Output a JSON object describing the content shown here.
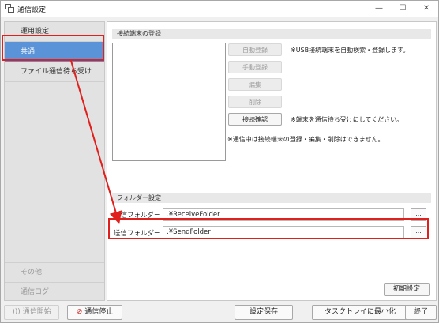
{
  "window": {
    "title": "通信設定",
    "minimize_glyph": "—",
    "maximize_glyph": "☐",
    "close_glyph": "✕"
  },
  "sidebar": {
    "items": [
      {
        "label": "運用設定"
      },
      {
        "label": "共通"
      },
      {
        "label": "ファイル通信待ち受け"
      },
      {
        "label": "その他"
      },
      {
        "label": "通信ログ"
      }
    ],
    "selected_index": 1
  },
  "device_group": {
    "header": "接続端末の登録",
    "buttons": {
      "auto_register": "自動登録",
      "manual_register": "手動登録",
      "edit": "編集",
      "delete": "削除",
      "confirm_connection": "接続確認"
    },
    "note_usb": "※USB接続端末を自動検索・登録します。",
    "note_wait": "※端末を通信待ち受けにしてください。",
    "note_busy": "※通信中は接続端末の登録・編集・削除はできません。"
  },
  "folder_group": {
    "header": "フォルダー設定",
    "receive_label": "受信フォルダー",
    "receive_value": ".¥ReceiveFolder",
    "send_label": "送信フォルダー",
    "send_value": ".¥SendFolder",
    "browse_label": "..."
  },
  "initial_settings_label": "初期設定",
  "footer": {
    "start_comm": "通信開始",
    "stop_comm": "通信停止",
    "save_settings": "設定保存",
    "minimize_tray": "タスクトレイに最小化",
    "exit": "終了"
  },
  "colors": {
    "selected_bg": "#5b93d8",
    "highlight_red": "#e0201c"
  }
}
